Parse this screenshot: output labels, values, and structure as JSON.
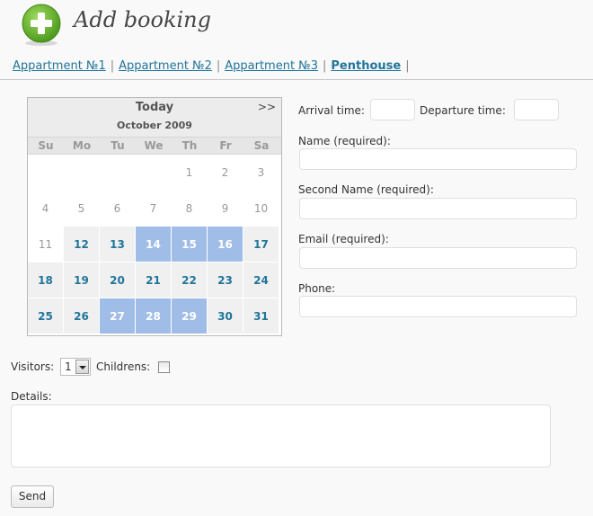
{
  "page": {
    "title": "Add booking"
  },
  "tabs": [
    {
      "label": "Appartment №1",
      "current": false
    },
    {
      "label": "Appartment №2",
      "current": false
    },
    {
      "label": "Appartment №3",
      "current": false
    },
    {
      "label": "Penthouse",
      "current": true
    }
  ],
  "calendar": {
    "today_label": "Today",
    "next_label": ">>",
    "month_label": "October 2009",
    "weekdays": [
      "Su",
      "Mo",
      "Tu",
      "We",
      "Th",
      "Fr",
      "Sa"
    ],
    "weeks": [
      [
        {
          "day": "",
          "state": "empty"
        },
        {
          "day": "",
          "state": "empty"
        },
        {
          "day": "",
          "state": "empty"
        },
        {
          "day": "",
          "state": "empty"
        },
        {
          "day": "1",
          "state": "past"
        },
        {
          "day": "2",
          "state": "past"
        },
        {
          "day": "3",
          "state": "past"
        }
      ],
      [
        {
          "day": "4",
          "state": "past"
        },
        {
          "day": "5",
          "state": "past"
        },
        {
          "day": "6",
          "state": "past"
        },
        {
          "day": "7",
          "state": "past"
        },
        {
          "day": "8",
          "state": "past"
        },
        {
          "day": "9",
          "state": "past"
        },
        {
          "day": "10",
          "state": "past"
        }
      ],
      [
        {
          "day": "11",
          "state": "past"
        },
        {
          "day": "12",
          "state": "avail"
        },
        {
          "day": "13",
          "state": "avail"
        },
        {
          "day": "14",
          "state": "booked"
        },
        {
          "day": "15",
          "state": "booked"
        },
        {
          "day": "16",
          "state": "booked"
        },
        {
          "day": "17",
          "state": "avail"
        }
      ],
      [
        {
          "day": "18",
          "state": "avail"
        },
        {
          "day": "19",
          "state": "avail"
        },
        {
          "day": "20",
          "state": "avail"
        },
        {
          "day": "21",
          "state": "avail"
        },
        {
          "day": "22",
          "state": "avail"
        },
        {
          "day": "23",
          "state": "avail"
        },
        {
          "day": "24",
          "state": "avail"
        }
      ],
      [
        {
          "day": "25",
          "state": "avail"
        },
        {
          "day": "26",
          "state": "avail"
        },
        {
          "day": "27",
          "state": "booked"
        },
        {
          "day": "28",
          "state": "booked"
        },
        {
          "day": "29",
          "state": "booked"
        },
        {
          "day": "30",
          "state": "avail"
        },
        {
          "day": "31",
          "state": "avail"
        }
      ]
    ]
  },
  "form": {
    "arrival_label": "Arrival time:",
    "arrival_value": "",
    "departure_label": "Departure time:",
    "departure_value": "",
    "name_label": "Name (required):",
    "name_value": "",
    "second_name_label": "Second Name (required):",
    "second_name_value": "",
    "email_label": "Email (required):",
    "email_value": "",
    "phone_label": "Phone:",
    "phone_value": "",
    "visitors_label": "Visitors:",
    "visitors_value": "1",
    "childrens_label": "Childrens:",
    "childrens_checked": false,
    "details_label": "Details:",
    "details_value": "",
    "send_label": "Send"
  },
  "icons": {
    "add": "plus-circle-icon",
    "next": "double-chevron-right",
    "dropdown": "triangle-down-icon"
  },
  "colors": {
    "accent": "#21759b",
    "booked": "#a0bde8",
    "icon_green": "#69b92e"
  }
}
